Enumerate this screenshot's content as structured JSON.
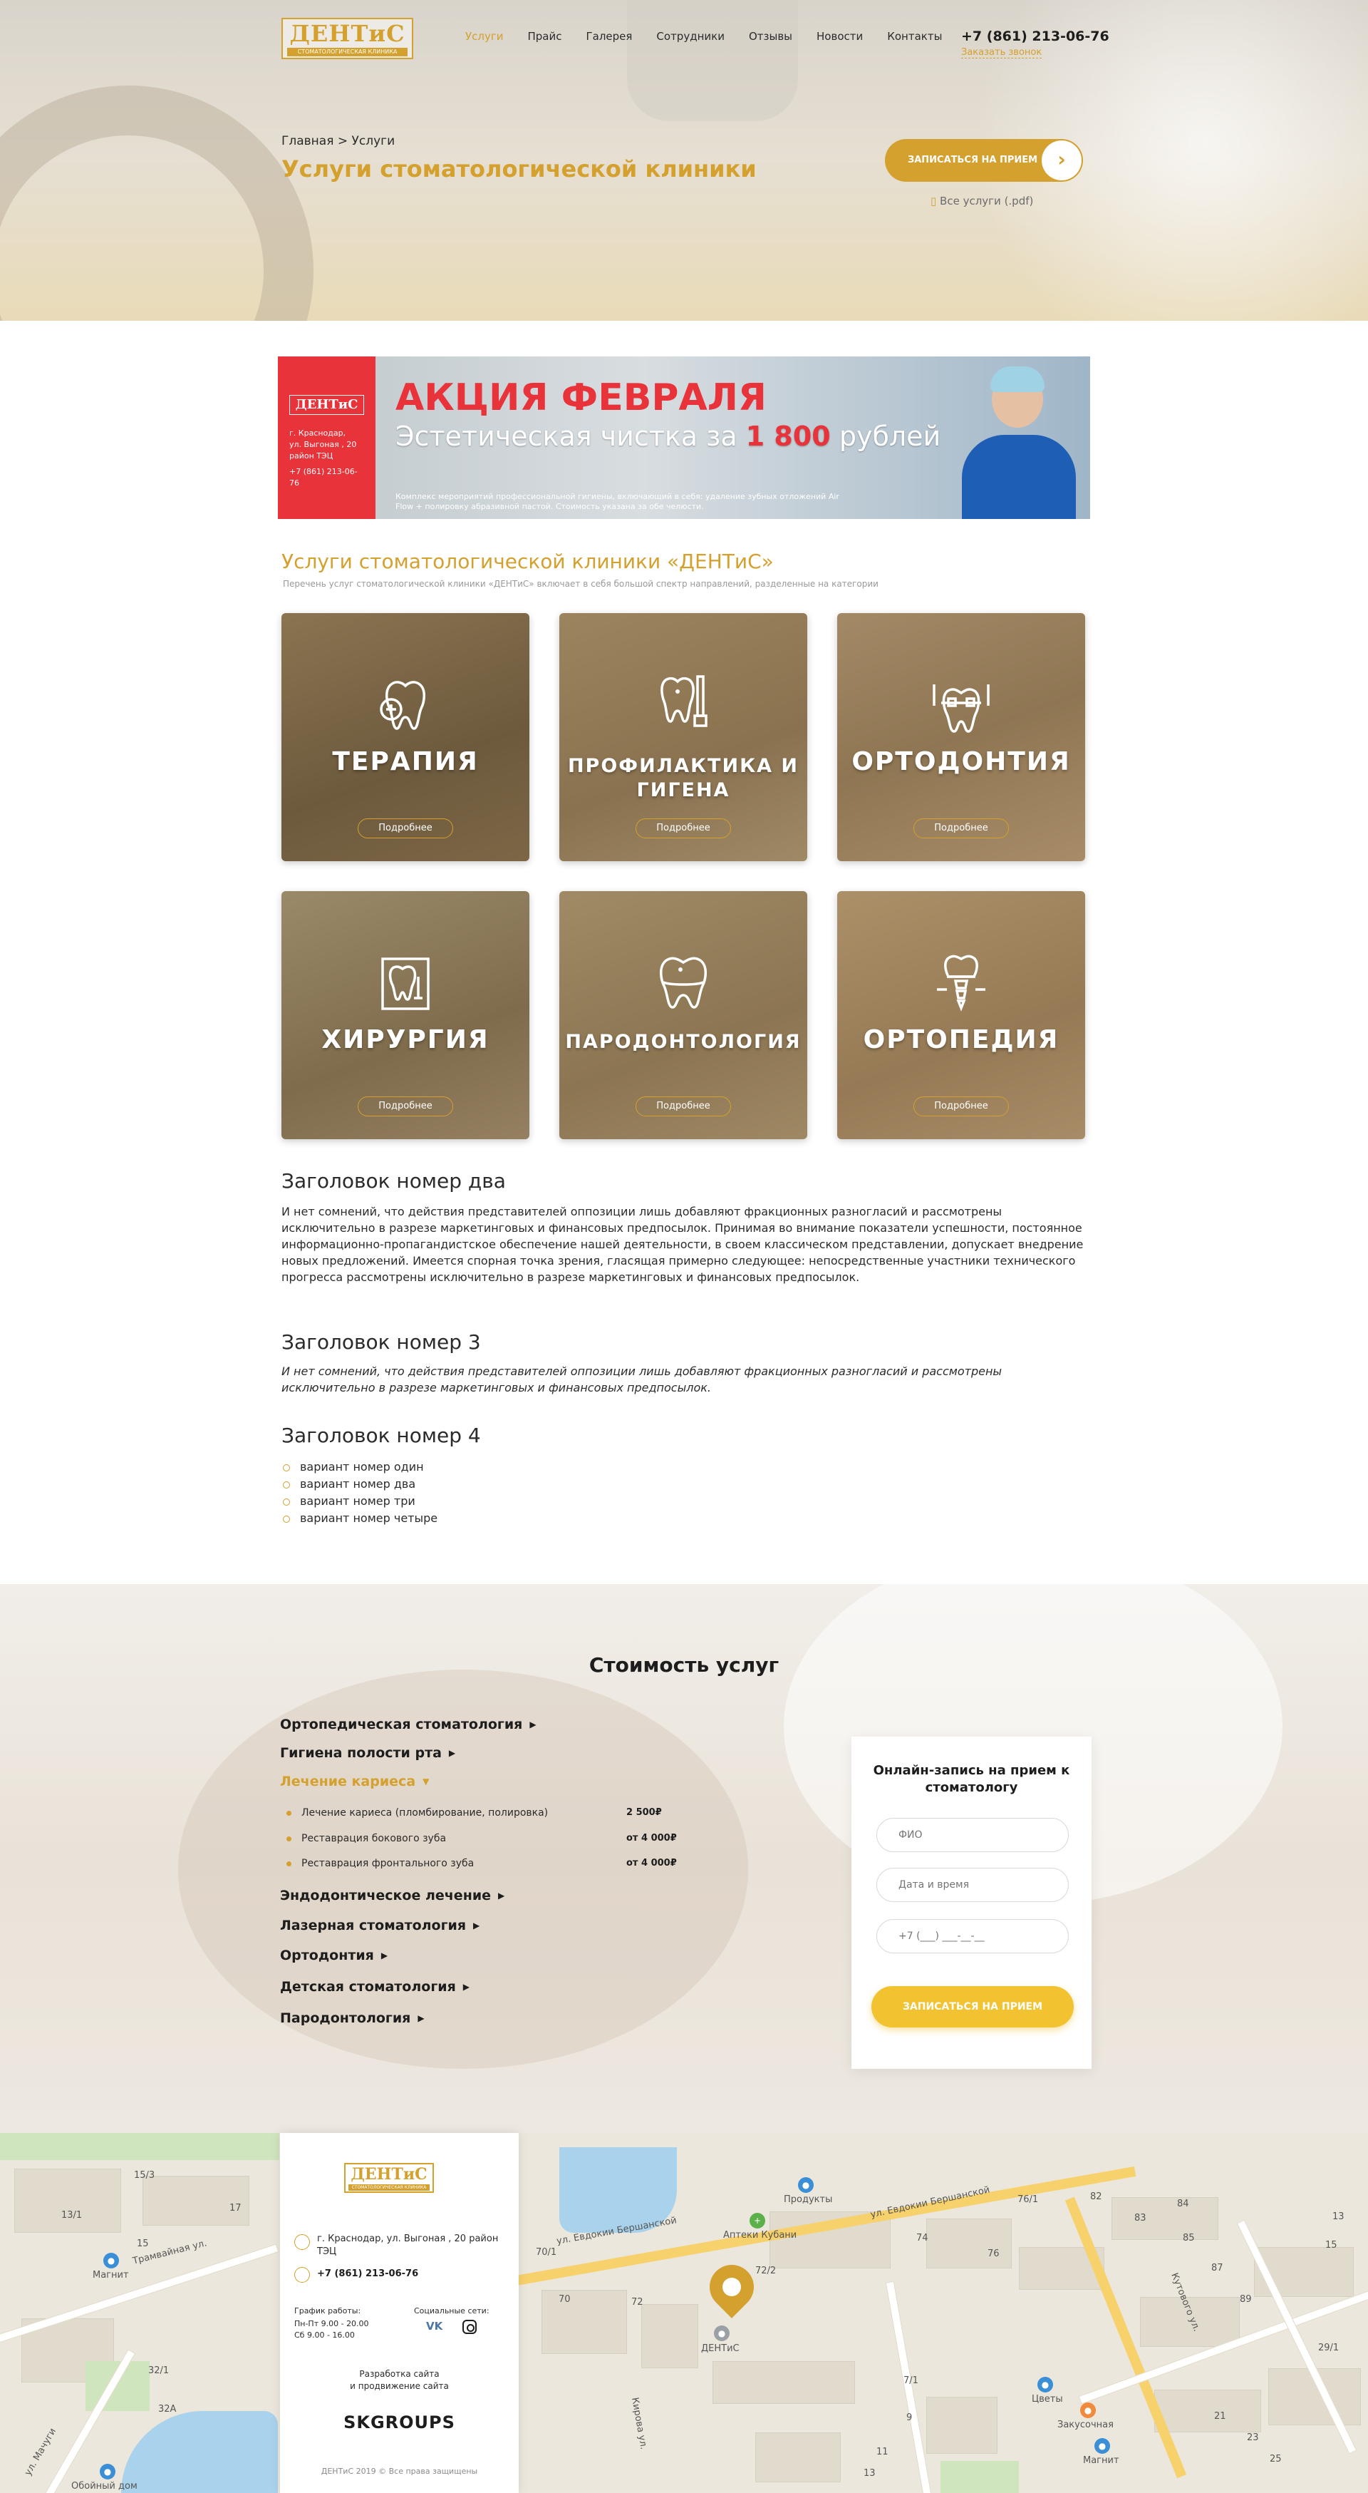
{
  "header": {
    "logo": {
      "text": "ДЕНТиС",
      "sub": "СТОМАТОЛОГИЧЕСКАЯ КЛИНИКА"
    },
    "nav": [
      "Услуги",
      "Прайс",
      "Галерея",
      "Сотрудники",
      "Отзывы",
      "Новости",
      "Контакты"
    ],
    "nav_active": "Услуги",
    "phone": "+7 (861) 213-06-76",
    "callback": "Заказать звонок"
  },
  "hero": {
    "breadcrumb_home": "Главная",
    "breadcrumb_sep": " > ",
    "breadcrumb_current": "Услуги",
    "title": "Услуги стоматологической клиники",
    "cta": "ЗАПИСАТЬСЯ НА ПРИЕМ",
    "pdf_link": "Все услуги (.pdf)"
  },
  "promo": {
    "logo": "ДЕНТиС",
    "address": [
      "г. Краснодар,",
      "ул. Выгоная , 20",
      "район ТЭЦ"
    ],
    "phone": "+7 (861) 213-06-76",
    "title": "АКЦИЯ ФЕВРАЛЯ",
    "subtitle_pre": "Эстетическая чистка за ",
    "price": "1 800",
    "subtitle_post": " рублей",
    "note": "Комплекс мероприятий профессиональной гигиены, включающий в себя: удаление зубных отложений Air Flow + полировку абразивной пастой. Стоимость указана за обе челюсти."
  },
  "services": {
    "title": "Услуги стоматологической клиники «ДЕНТиС»",
    "subtitle": "Перечень услуг стоматологической клиники «ДЕНТиС» включает в себя большой спектр направлений, разделенные на категории",
    "more_label": "Подробнее",
    "cards": [
      {
        "title": "ТЕРАПИЯ",
        "icon": "tooth-shield-icon"
      },
      {
        "title": "ПРОФИЛАКТИКА И ГИГЕНА",
        "icon": "toothbrush-icon"
      },
      {
        "title": "ОРТОДОНТИЯ",
        "icon": "braces-icon"
      },
      {
        "title": "ХИРУРГИЯ",
        "icon": "tooth-surgery-icon"
      },
      {
        "title": "ПАРОДОНТОЛОГИЯ",
        "icon": "tooth-gum-icon"
      },
      {
        "title": "ОРТОПЕДИЯ",
        "icon": "tooth-implant-icon"
      }
    ]
  },
  "content": {
    "h2": "Заголовок номер два",
    "p1": "И нет сомнений, что действия представителей оппозиции лишь добавляют фракционных разногласий и рассмотрены исключительно в разрезе маркетинговых и финансовых предпосылок. Принимая во внимание показатели успешности, постоянное информационно-пропагандистское обеспечение нашей деятельности, в своем классическом представлении, допускает внедрение новых предложений. Имеется спорная точка зрения, гласящая примерно следующее: непосредственные участники технического прогресса рассмотрены исключительно в разрезе маркетинговых и финансовых предпосылок.",
    "h3": "Заголовок номер 3",
    "p2": "И нет сомнений, что действия представителей оппозиции лишь добавляют фракционных разногласий и рассмотрены исключительно в разрезе маркетинговых и финансовых предпосылок.",
    "h4": "Заголовок номер 4",
    "list": [
      "вариант номер один",
      "вариант номер два",
      "вариант номер три",
      "вариант номер четыре"
    ]
  },
  "prices": {
    "title": "Стоимость услуг",
    "categories": [
      "Ортопедическая стоматология",
      "Гигиена полости рта",
      "Лечение кариеса",
      "Эндодонтическое лечение",
      "Лазерная стоматология",
      "Ортодонтия",
      "Детская стоматология",
      "Пародонтология"
    ],
    "open_category": "Лечение кариеса",
    "items": [
      {
        "name": "Лечение кариеса (пломбирование, полировка)",
        "price": "2 500₽"
      },
      {
        "name": "Реставрация бокового зуба",
        "price": "от 4 000₽"
      },
      {
        "name": "Реставрация фронтального зуба",
        "price": "от 4 000₽"
      }
    ]
  },
  "form": {
    "title": "Онлайн-запись на прием к стоматологу",
    "name_placeholder": "ФИО",
    "date_placeholder": "Дата и время",
    "phone_placeholder": "+7 (___) ___-__-__",
    "submit": "ЗАПИСАТЬСЯ НА ПРИЕМ"
  },
  "footer": {
    "logo": "ДЕНТиС",
    "address": "г. Краснодар, ул. Выгоная , 20 район ТЭЦ",
    "phone": "+7 (861) 213-06-76",
    "schedule_title": "График работы:",
    "schedule": [
      "Пн-Пт  9.00 - 20.00",
      "Сб  9.00 - 16.00"
    ],
    "social_title": "Социальные сети:",
    "vk": "VK",
    "dev_line1": "Разработка сайта",
    "dev_line2": "и продвижение сайта",
    "dev_brand": "SKGROUPS",
    "copyright": "ДЕНТиС 2019 © Все права защищены"
  },
  "map": {
    "labels": [
      "ул. Евдокии Бершанской",
      "ул. Евдокии Бершанской",
      "Трамвайная ул.",
      "Кирова ул.",
      "Кутового ул.",
      "Магнит",
      "Магнит",
      "Продукты",
      "Аптеки Кубани",
      "ДЕНТиС",
      "Цветы",
      "Закусочная",
      "Обойный дом",
      "ул. Мачуги"
    ],
    "house_numbers": [
      "15/3",
      "13/1",
      "15",
      "17",
      "70/1",
      "70",
      "72",
      "72/2",
      "74",
      "76",
      "76/1",
      "82",
      "83",
      "84",
      "85",
      "87",
      "89",
      "7/1",
      "9",
      "11",
      "13",
      "32/1",
      "32A",
      "29/1",
      "21",
      "23",
      "25",
      "15",
      "13"
    ]
  },
  "colors": {
    "accent": "#d4a02e",
    "promo_red": "#e8333a",
    "button_yellow": "#f2c230"
  }
}
